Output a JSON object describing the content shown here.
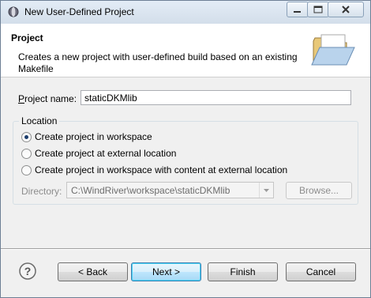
{
  "window": {
    "title": "New User-Defined Project"
  },
  "header": {
    "title": "Project",
    "description": "Creates a new project with user-defined build based on an existing Makefile",
    "icon": "folder-icon"
  },
  "form": {
    "project_name_label": "Project name:",
    "project_name_value": "staticDKMlib",
    "location_group_title": "Location",
    "location_options": [
      {
        "label": "Create project in workspace",
        "selected": true
      },
      {
        "label": "Create project at external location",
        "selected": false
      },
      {
        "label": "Create project in workspace with content at external location",
        "selected": false
      }
    ],
    "directory_label": "Directory:",
    "directory_value": "C:\\WindRiver\\workspace\\staticDKMlib",
    "browse_label": "Browse..."
  },
  "buttons": {
    "back": "< Back",
    "next": "Next >",
    "finish": "Finish",
    "cancel": "Cancel"
  },
  "colors": {
    "accent_default_button": "#3c7fb1",
    "header_bg": "#ffffff",
    "dialog_bg": "#f0f0f0"
  }
}
